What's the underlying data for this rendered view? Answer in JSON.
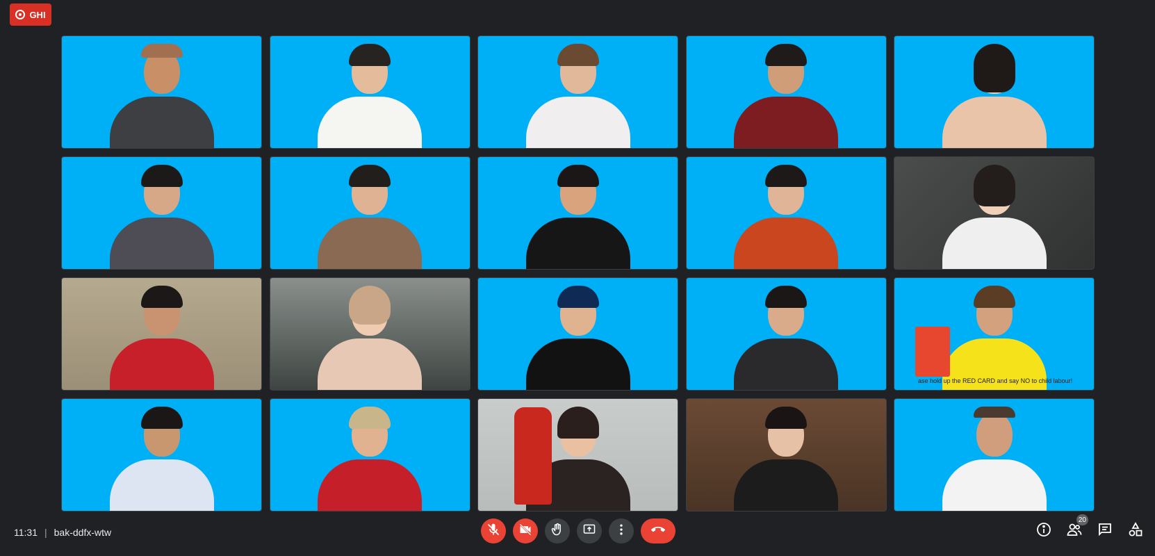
{
  "recording": {
    "label": "GHI"
  },
  "meeting": {
    "time": "11:31",
    "separator": "|",
    "code": "bak-ddfx-wtw"
  },
  "participants_count": "20",
  "tile_text": {
    "card_caption": "ase hold up the RED CARD and say NO to child labour!"
  },
  "colors": {
    "tile_bg": "#00b0f6",
    "accent_red": "#ea4335",
    "page_bg": "#202124"
  },
  "controls": {
    "icons": [
      "mic-off-icon",
      "camera-off-icon",
      "raise-hand-icon",
      "present-screen-icon",
      "more-options-icon",
      "end-call-icon"
    ],
    "right_icons": [
      "info-icon",
      "people-icon",
      "chat-icon",
      "activities-icon"
    ]
  }
}
